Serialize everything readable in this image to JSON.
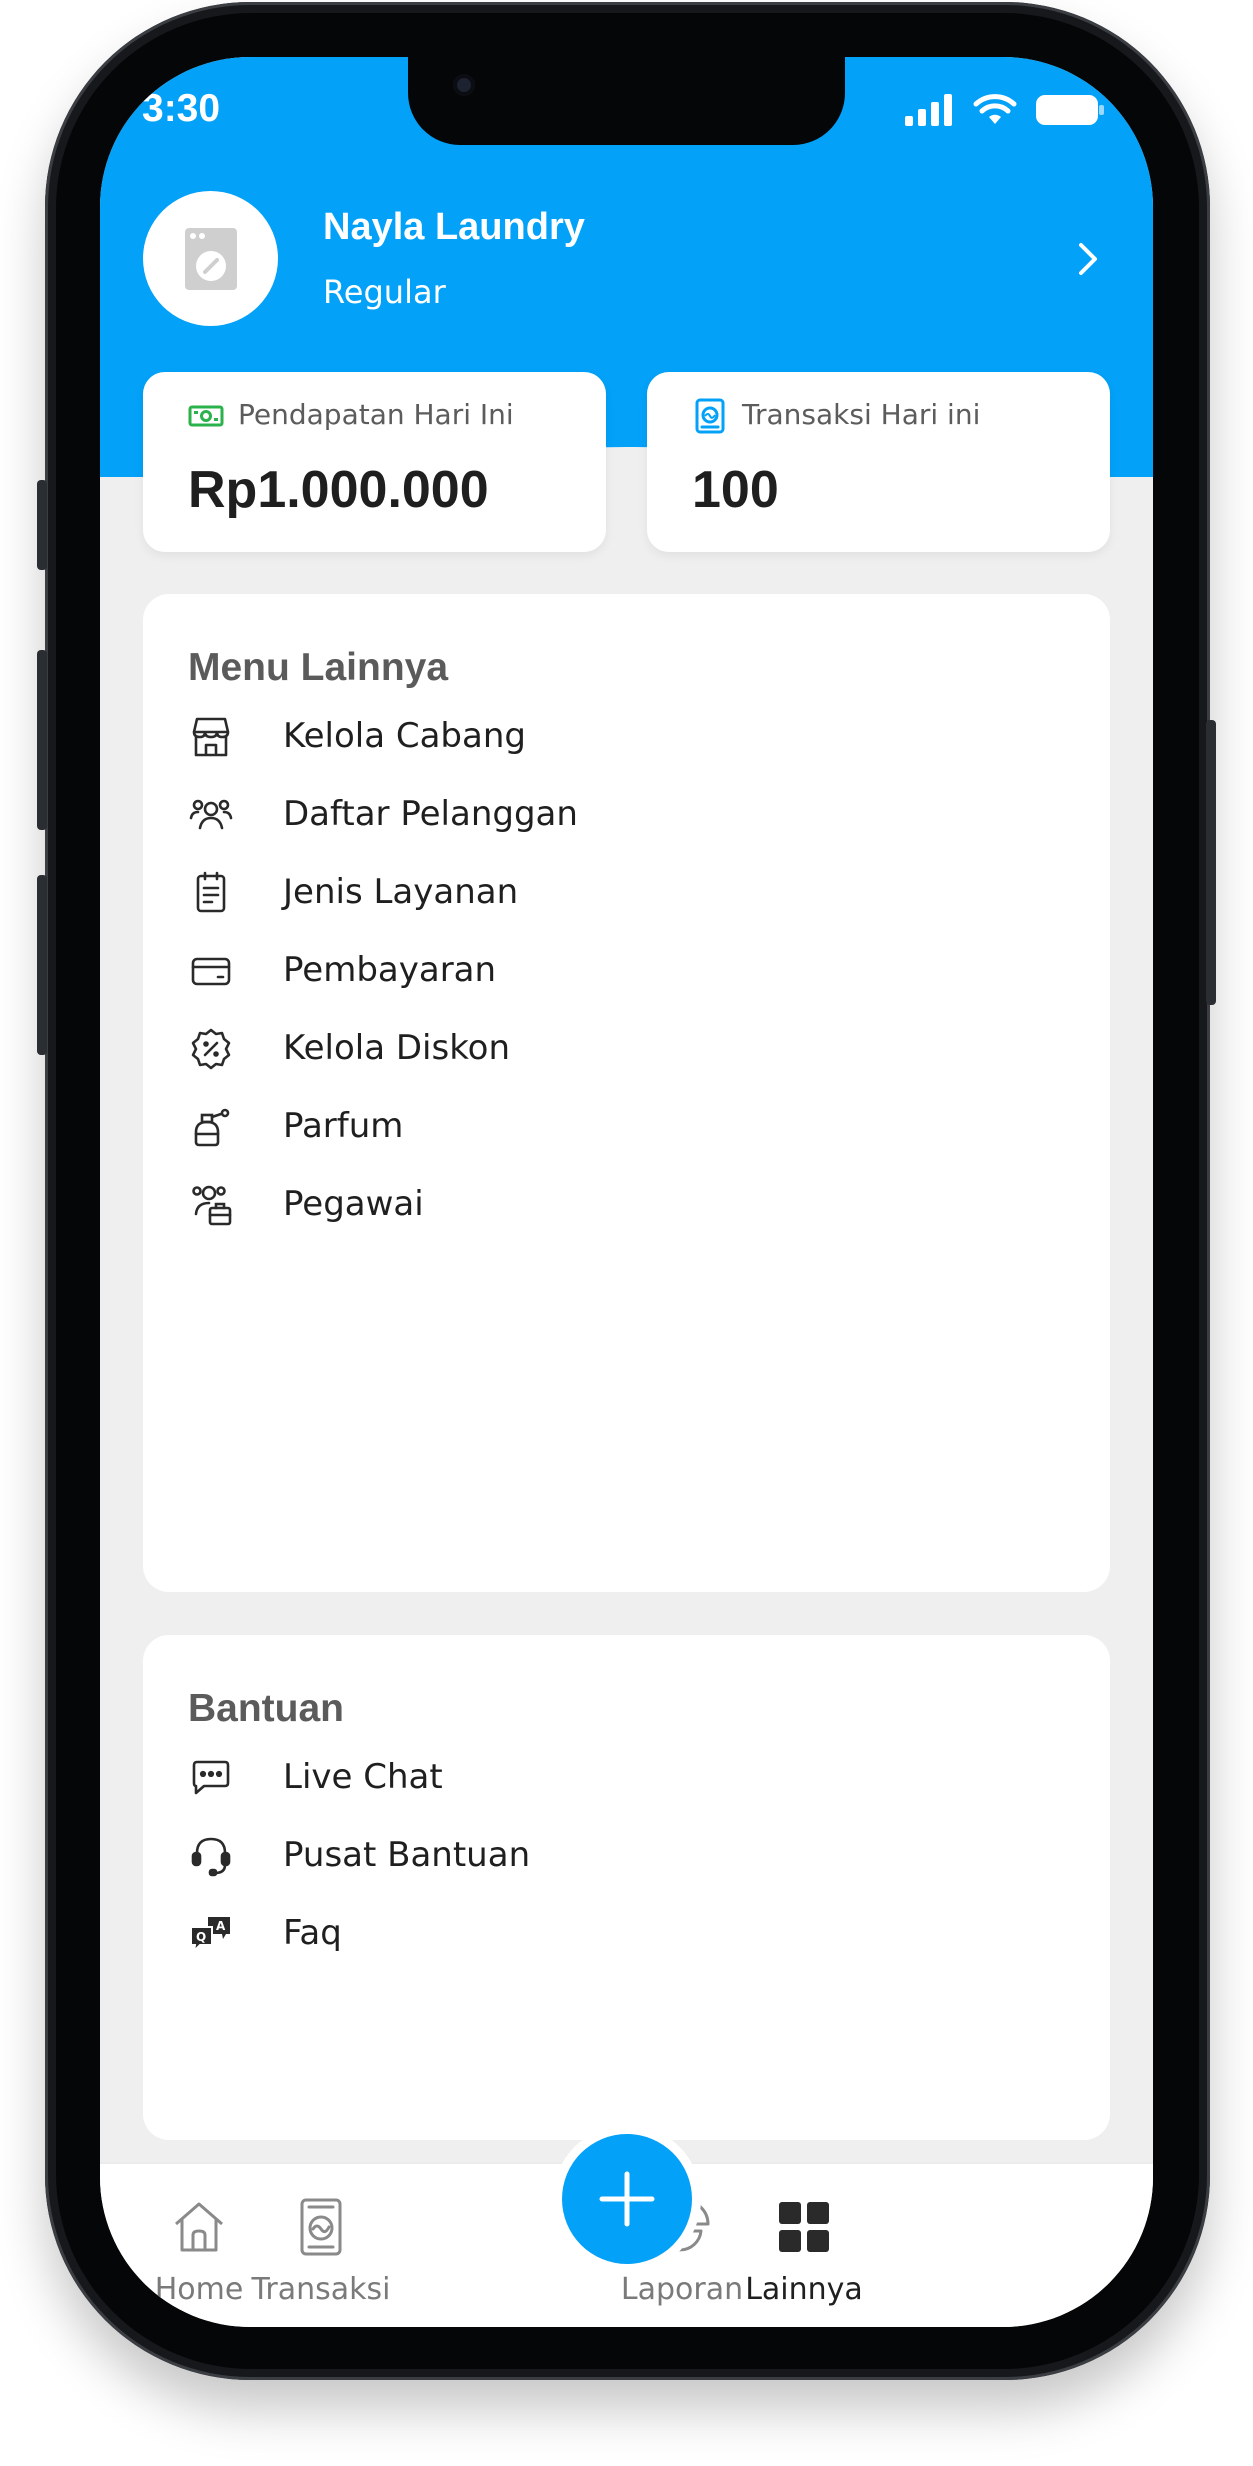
{
  "status_bar": {
    "time": "3:30",
    "icons": [
      "signal-icon",
      "wifi-icon",
      "battery-icon"
    ]
  },
  "profile": {
    "name": "Nayla Laundry",
    "tier": "Regular",
    "avatar_icon": "washing-machine-icon"
  },
  "stats": [
    {
      "label": "Pendapatan Hari Ini",
      "value": "Rp1.000.000",
      "icon": "money-icon",
      "icon_color": "#2bb24c"
    },
    {
      "label": "Transaksi Hari ini",
      "value": "100",
      "icon": "receipt-icon",
      "icon_color": "#03a1f8"
    }
  ],
  "menu": {
    "title": "Menu Lainnya",
    "items": [
      {
        "label": "Kelola Cabang",
        "icon": "store-icon"
      },
      {
        "label": "Daftar Pelanggan",
        "icon": "customers-icon"
      },
      {
        "label": "Jenis Layanan",
        "icon": "clipboard-icon"
      },
      {
        "label": "Pembayaran",
        "icon": "card-icon"
      },
      {
        "label": "Kelola Diskon",
        "icon": "discount-icon"
      },
      {
        "label": "Parfum",
        "icon": "perfume-icon"
      },
      {
        "label": "Pegawai",
        "icon": "employee-icon"
      }
    ]
  },
  "help": {
    "title": "Bantuan",
    "items": [
      {
        "label": "Live Chat",
        "icon": "chat-icon"
      },
      {
        "label": "Pusat Bantuan",
        "icon": "headset-icon"
      },
      {
        "label": "Faq",
        "icon": "faq-icon"
      }
    ]
  },
  "tabbar": {
    "items": [
      {
        "label": "Home",
        "icon": "home-icon",
        "active": false
      },
      {
        "label": "Transaksi",
        "icon": "transaction-icon",
        "active": false
      },
      {
        "label": "Laporan",
        "icon": "pie-chart-icon",
        "active": false
      },
      {
        "label": "Lainnya",
        "icon": "grid-icon",
        "active": true
      }
    ],
    "fab_icon": "plus-icon"
  },
  "colors": {
    "primary": "#03a1f8",
    "background": "#efefef",
    "card": "#ffffff",
    "text": "#1f1f1f",
    "muted": "#5b5b5b",
    "income_green": "#2bb24c"
  }
}
